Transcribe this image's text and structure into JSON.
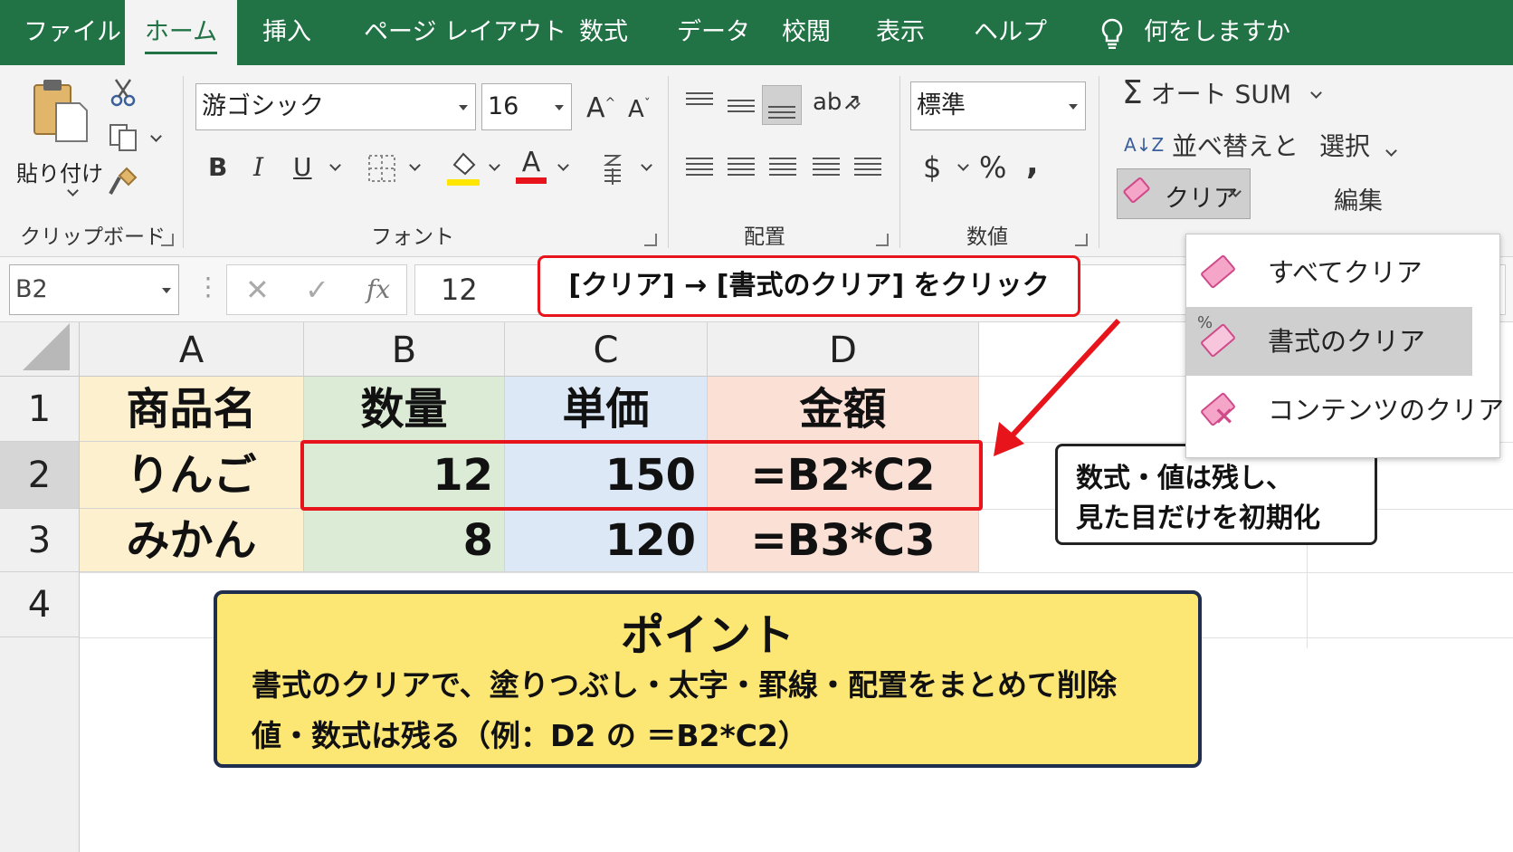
{
  "tabs": [
    "ファイル",
    "ホーム",
    "挿入",
    "ページ レイアウト",
    "数式",
    "データ",
    "校閲",
    "表示",
    "ヘルプ"
  ],
  "active_tab": "ホーム",
  "tell_me": "何をしますか",
  "clipboard": {
    "paste_label": "貼り付け",
    "group_label": "クリップボード"
  },
  "font": {
    "family": "游ゴシック",
    "size": "16",
    "grow": "A",
    "shrink": "A",
    "bold": "B",
    "italic": "I",
    "underline": "U",
    "font_color": "A",
    "group_label": "フォント"
  },
  "alignment": {
    "group_label": "配置"
  },
  "number": {
    "format": "標準",
    "currency": "$",
    "percent": "%",
    "comma": ",",
    "group_label": "数値"
  },
  "editing": {
    "autosum": "オート SUM",
    "sort": "並べ替えと",
    "select": "選択",
    "clear": "クリア",
    "group_label": "編集"
  },
  "colors": {
    "excel_green": "#217346",
    "highlight_red": "#e8141b",
    "callout_yellow": "#fde774",
    "callout_border": "#1f2d4e"
  },
  "clear_menu": {
    "items": [
      "すべてクリア",
      "書式のクリア",
      "コンテンツのクリア"
    ],
    "highlighted": "書式のクリア"
  },
  "formula_bar": {
    "name_box": "B2",
    "fx": "fx",
    "value": "12"
  },
  "instruction_callout": "[クリア] → [書式のクリア] をクリック",
  "columns": [
    "A",
    "B",
    "C",
    "D"
  ],
  "rows": [
    "1",
    "2",
    "3",
    "4"
  ],
  "table": {
    "header": [
      "商品名",
      "数量",
      "単価",
      "金額"
    ],
    "rows": [
      [
        "りんご",
        "12",
        "150",
        "=B2*C2"
      ],
      [
        "みかん",
        "8",
        "120",
        "=B3*C3"
      ]
    ]
  },
  "side_note": {
    "line1": "数式・値は残し、",
    "line2": "見た目だけを初期化"
  },
  "point_box": {
    "title": "ポイント",
    "line1": "書式のクリアで、塗りつぶし・太字・罫線・配置をまとめて削除",
    "line2": "値・数式は残る（例：D2 の ＝B2*C2）"
  }
}
